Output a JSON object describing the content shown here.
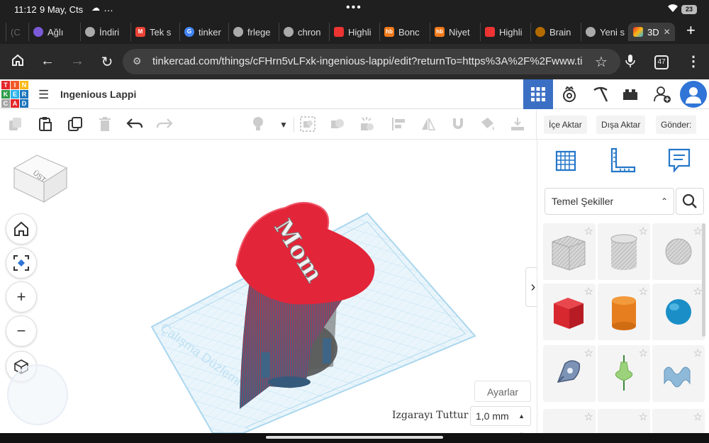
{
  "status_bar": {
    "time": "11:12",
    "date": "9 May, Cts",
    "battery": "23"
  },
  "browser": {
    "tabs": [
      {
        "label": "(C",
        "color": "#555"
      },
      {
        "label": "Ağlı",
        "color": "#7b5ad8"
      },
      {
        "label": "İndiri",
        "color": "#aaa"
      },
      {
        "label": "Tek s",
        "color": "#ea4335"
      },
      {
        "label": "tinker",
        "color": "#4285f4"
      },
      {
        "label": "frlege",
        "color": "#aaa"
      },
      {
        "label": "chron",
        "color": "#aaa"
      },
      {
        "label": "Highli",
        "color": "#e33"
      },
      {
        "label": "Bonc",
        "color": "#f27a1a"
      },
      {
        "label": "Niyet",
        "color": "#f27a1a"
      },
      {
        "label": "Highli",
        "color": "#e33"
      },
      {
        "label": "Brain",
        "color": "#b36b00"
      },
      {
        "label": "Yeni s",
        "color": "#aaa"
      },
      {
        "label": "3D",
        "color": "#f4b400"
      }
    ],
    "fav_text_hb": "hb",
    "url": "tinkercad.com/things/cFHrn5vLFxk-ingenious-lappi/edit?returnTo=https%3A%2F%2Fwww.tinkercad.com",
    "tab_count": "47"
  },
  "tinkercad": {
    "logo_letters": [
      "T",
      "I",
      "N",
      "K",
      "E",
      "R",
      "C",
      "A",
      "D"
    ],
    "logo_colors": [
      "#e4262a",
      "#f1592a",
      "#fcb813",
      "#2d9b47",
      "#2bb2e8",
      "#1c75bc",
      "#a6a6a6",
      "#e4262a",
      "#1c75bc"
    ],
    "project_title": "Ingenious Lappi",
    "import_label": "İçe Aktar",
    "export_label": "Dışa Aktar",
    "send_label": "Gönder:",
    "library_select": "Temel Şekiller",
    "settings_label": "Ayarlar",
    "snap_label": "Izgarayı Tuttur",
    "snap_value": "1,0 mm",
    "workplane_label": "Çalışma Düzlemi",
    "viewcube_label": "ÜST",
    "model_text": "Mom"
  },
  "colors": {
    "accent": "#3b6fc4",
    "heart_red": "#e3253a",
    "base_blue": "#3e6585",
    "grid": "#a9d6ee"
  }
}
